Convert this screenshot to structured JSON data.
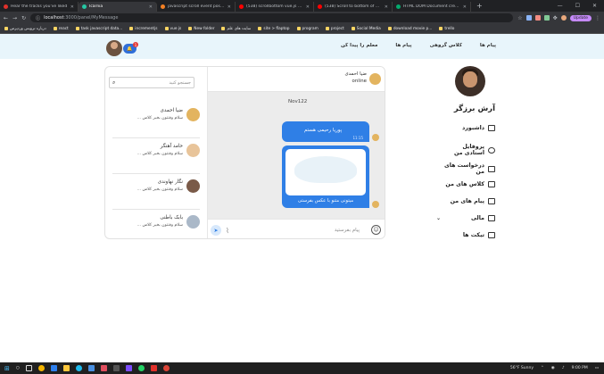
{
  "browser": {
    "tabs": [
      {
        "title": "Hear the tracks you've liked",
        "active": false,
        "color": "#e0312b"
      },
      {
        "title": "Icarnia",
        "active": true,
        "color": "#25c7a3"
      },
      {
        "title": "javascript scroll event position",
        "active": false,
        "color": "#f48024"
      },
      {
        "title": "(538) scrollbottom vue.js - YouT",
        "active": false,
        "color": "#ff0000"
      },
      {
        "title": "(538) Scroll to bottom of div wi",
        "active": false,
        "color": "#ff0000"
      },
      {
        "title": "HTML DOM Document createT",
        "active": false,
        "color": "#04aa6d"
      }
    ],
    "new_tab": "+",
    "url_host": "localhost",
    "url_rest": ":3000/panel/MyMessage",
    "update_label": "Update",
    "bookmarks": [
      "درباره ترویس وردپرس",
      "react",
      "task javascript data...",
      "incrementjs",
      "vue js",
      "New folder",
      "سایت های علم",
      "site > flaptop",
      "program",
      "project",
      "Social Media",
      "download movie p...",
      "trello"
    ]
  },
  "nav": {
    "links": [
      "پیام ها",
      "کلاس گروهی",
      "پیام ها",
      "معلم را پیدا کن"
    ],
    "notification_count": "1"
  },
  "sidebar": {
    "name": "آرش برزگر",
    "menu": [
      {
        "label": "داشبورد",
        "icon": "dashboard-icon"
      },
      {
        "label": "پروفایل استادی من",
        "icon": "user-icon"
      },
      {
        "label": "درخواست های من",
        "icon": "clipboard-icon"
      },
      {
        "label": "کلاس های من",
        "icon": "teacher-icon"
      },
      {
        "label": "پیام های من",
        "icon": "edit-message-icon"
      },
      {
        "label": "مالی",
        "icon": "wallet-icon"
      },
      {
        "label": "تیکت ها",
        "icon": "ticket-icon"
      }
    ]
  },
  "chat": {
    "search_placeholder": "جستجو کنید",
    "conversations": [
      {
        "name": "ضیا احمدی",
        "preview": "سلام وقتتون بخیر کلاس ..."
      },
      {
        "name": "حامد آهنگر",
        "preview": "سلام وقتتون بخیر کلاس ..."
      },
      {
        "name": "نگار نهاوندی",
        "preview": "سلام وقتتون بخیر کلاس ..."
      },
      {
        "name": "بابک باطنی",
        "preview": "سلام وقتتون بخیر کلاس ..."
      }
    ],
    "header": {
      "name": "ضیا احمدی",
      "status": "online"
    },
    "date_label": "Nov122",
    "messages": [
      {
        "text": "پوریا رحیمی هستم",
        "time": "11:15"
      },
      {
        "text": "میتونی متنو با عکس بفرستی"
      }
    ],
    "composer_placeholder": "پیام بفرستید"
  },
  "taskbar": {
    "weather": "56°F  Sunny",
    "time": "9:00 PM"
  }
}
